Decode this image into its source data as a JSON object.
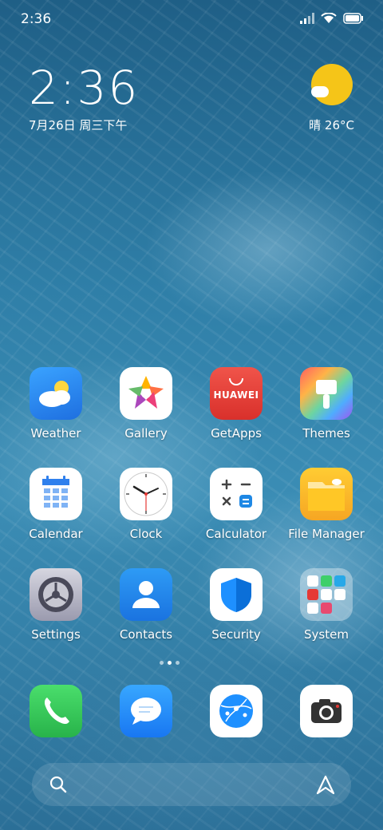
{
  "status": {
    "time": "2:36"
  },
  "clock": {
    "time": "2:36",
    "date": "7月26日 周三下午"
  },
  "weather": {
    "text": "晴 26°C"
  },
  "apps": [
    {
      "label": "Weather"
    },
    {
      "label": "Gallery"
    },
    {
      "label": "GetApps",
      "brand": "HUAWEI"
    },
    {
      "label": "Themes"
    },
    {
      "label": "Calendar"
    },
    {
      "label": "Clock"
    },
    {
      "label": "Calculator"
    },
    {
      "label": "File Manager"
    },
    {
      "label": "Settings"
    },
    {
      "label": "Contacts"
    },
    {
      "label": "Security"
    },
    {
      "label": "System"
    }
  ],
  "dock": [
    {
      "icon": "phone-icon"
    },
    {
      "icon": "messages-icon"
    },
    {
      "icon": "browser-icon"
    },
    {
      "icon": "camera-icon"
    }
  ],
  "colors": {
    "sun": "#f5c518",
    "huawei_red": "#e5403a",
    "phone_green": "#3dcc5c",
    "blue": "#1e88e5"
  }
}
